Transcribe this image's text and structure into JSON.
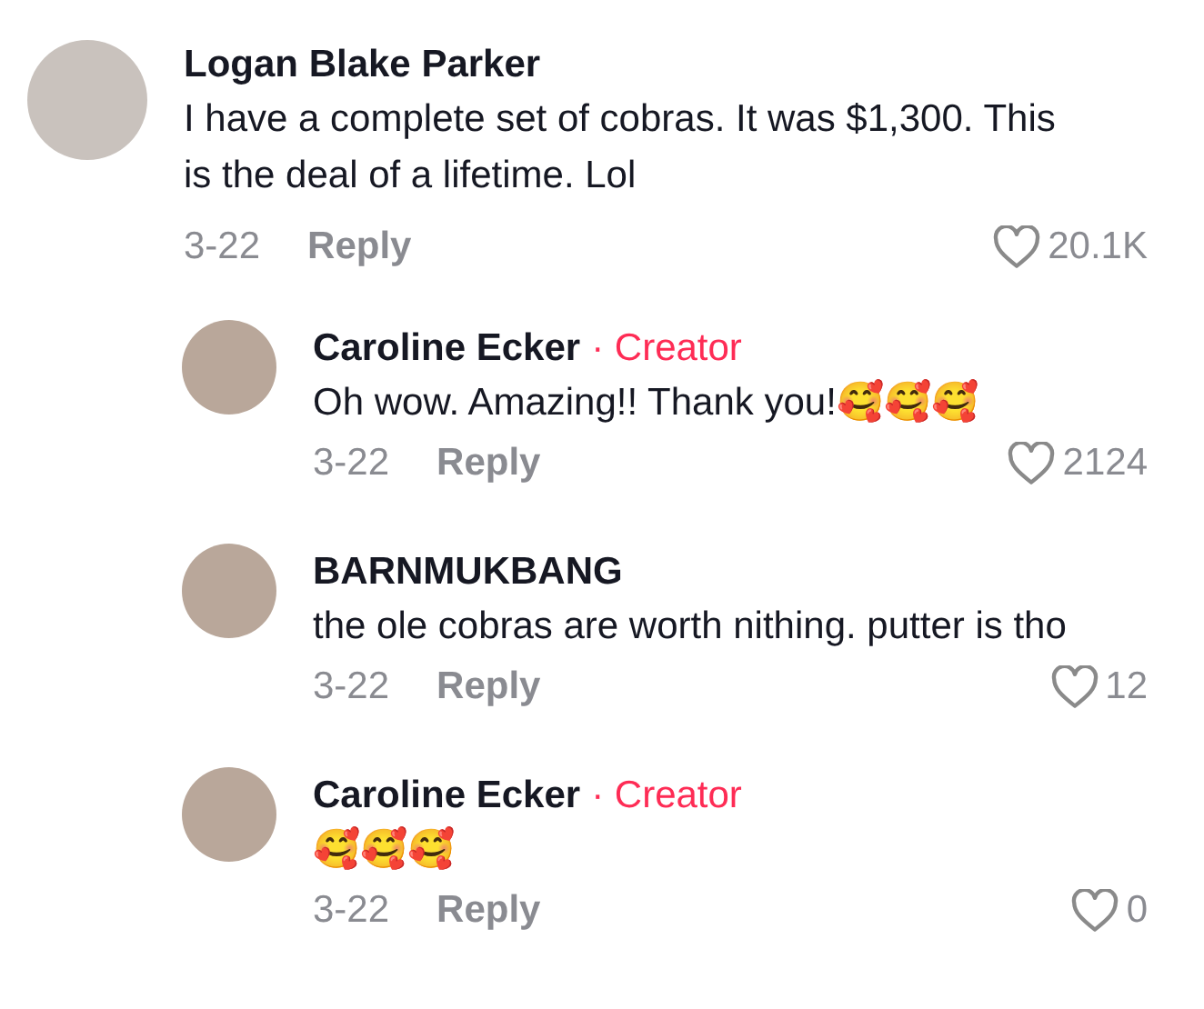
{
  "comments": [
    {
      "author": "Logan Blake Parker",
      "text": "I have a complete set of cobras. It was $1,300. This is the deal of a lifetime. Lol",
      "date": "3-22",
      "reply": "Reply",
      "likes": "20.1K",
      "liked": false,
      "kind": "top"
    },
    {
      "author": "Caroline Ecker",
      "creator_label": "· Creator",
      "text": "Oh wow. Amazing!! Thank you!🥰🥰🥰",
      "date": "3-22",
      "reply": "Reply",
      "likes": "2124",
      "liked": false,
      "kind": "reply"
    },
    {
      "author": "BARNMUKBANG",
      "text": "the ole cobras are worth nithing. putter is tho",
      "date": "3-22",
      "reply": "Reply",
      "likes": "12",
      "liked": false,
      "kind": "reply"
    },
    {
      "author": "Caroline Ecker",
      "creator_label": "· Creator",
      "text": "🥰🥰🥰",
      "date": "3-22",
      "reply": "Reply",
      "likes": "0",
      "liked": false,
      "kind": "reply"
    }
  ]
}
